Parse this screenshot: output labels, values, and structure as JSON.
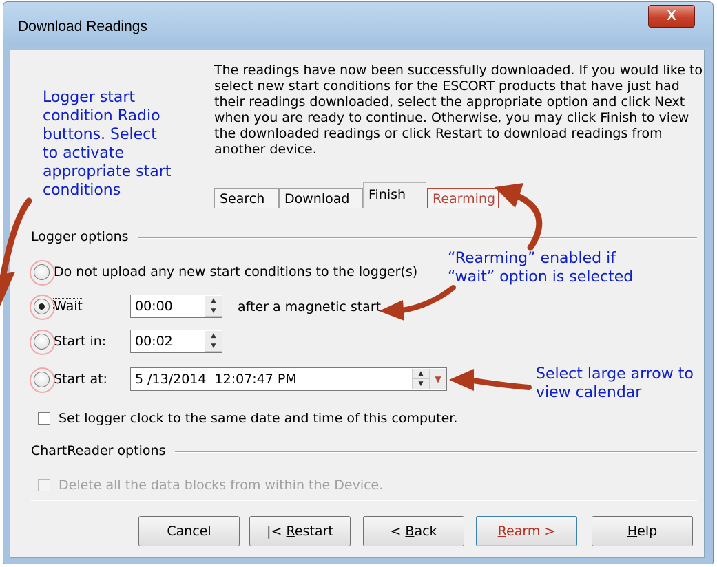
{
  "window": {
    "title": "Download Readings",
    "close_glyph": "X"
  },
  "intro_text": "The readings have now been successfully downloaded. If you would like to select new start conditions for the ESCORT products that have just had their readings downloaded, select the appropriate option and click Next when you are ready to continue. Otherwise, you may click Finish to view the downloaded readings or click Restart to download readings from another device.",
  "tabs": [
    {
      "label": "Search"
    },
    {
      "label": "Download"
    },
    {
      "label": "Finish",
      "active": true
    },
    {
      "label": "Rearming",
      "color": "#b5463a"
    }
  ],
  "logger_options": {
    "heading": "Logger options",
    "no_upload": {
      "label": "Do not upload any new start conditions to the logger(s)",
      "checked": false
    },
    "wait": {
      "label": "Wait",
      "value": "00:00",
      "suffix": "after a magnetic start",
      "checked": true
    },
    "start_in": {
      "label": "Start in:",
      "value": "00:02",
      "checked": false
    },
    "start_at": {
      "label": "Start at:",
      "value": "5 /13/2014  12:07:47 PM",
      "checked": false
    },
    "set_clock": {
      "label": "Set logger clock to the same date and time of this computer.",
      "checked": false
    }
  },
  "chartreader_options": {
    "heading": "ChartReader options",
    "delete_blocks": {
      "label": "Delete all the data blocks from within the Device.",
      "enabled": false
    }
  },
  "buttons": {
    "cancel": "Cancel",
    "restart_prefix": "|< ",
    "restart_mnemonic": "R",
    "restart_rest": "estart",
    "back_prefix": "< ",
    "back_mnemonic": "B",
    "back_rest": "ack",
    "rearm_mnemonic": "R",
    "rearm_rest": "earm >",
    "help_mnemonic": "H",
    "help_rest": "elp"
  },
  "annotations": {
    "radio_note": [
      "Logger start",
      "condition Radio",
      "buttons. Select",
      "to activate",
      "appropriate start",
      "conditions"
    ],
    "rearming_note": [
      "“Rearming” enabled if",
      "“wait” option is selected"
    ],
    "calendar_note": [
      "Select large arrow to",
      "view calendar"
    ],
    "color": "#1020c8",
    "arrow_color": "#b03a1c"
  }
}
